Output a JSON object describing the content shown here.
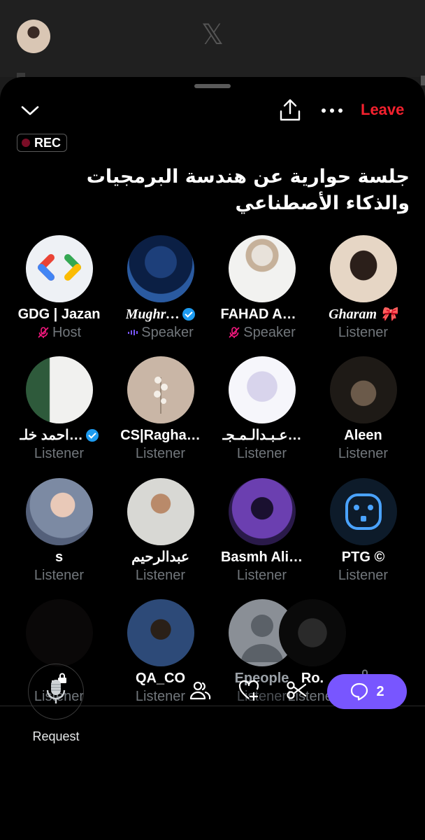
{
  "space": {
    "rec_label": "REC",
    "title": "جلسة حوارية عن هندسة البرمجيات والذكاء الأصطناعي",
    "leave_label": "Leave"
  },
  "participants": [
    {
      "name": "GDG | Jazan",
      "role": "Host",
      "muted": true
    },
    {
      "name": "Mughr…",
      "role": "Speaker",
      "verified": true,
      "speaking": true
    },
    {
      "name": "FAHAD AL…",
      "role": "Speaker",
      "muted": true
    },
    {
      "name": "Gharam 🎀",
      "role": "Listener"
    },
    {
      "name": "احمد خلـ…",
      "role": "Listener",
      "verified": true
    },
    {
      "name": "CS|Ragha…",
      "role": "Listener"
    },
    {
      "name": "عـبـدالـمـجـ…",
      "role": "Listener"
    },
    {
      "name": "Aleen",
      "role": "Listener"
    },
    {
      "name": "s",
      "role": "Listener"
    },
    {
      "name": "عبدالرحيم",
      "role": "Listener"
    },
    {
      "name": "Basmh Ali…",
      "role": "Listener"
    },
    {
      "name": "PTG ©",
      "role": "Listener"
    },
    {
      "name": ".",
      "role": "Listener",
      "locked": true
    },
    {
      "name": "QA_CO",
      "role": "Listener"
    },
    {
      "name": "Epeople",
      "role": "Listener"
    },
    {
      "name": "Ro.",
      "role": "Listener"
    },
    {
      "name": "",
      "role": "Listener",
      "locked": true
    }
  ],
  "bottom_bar": {
    "request_label": "Request",
    "chat_count": "2"
  }
}
